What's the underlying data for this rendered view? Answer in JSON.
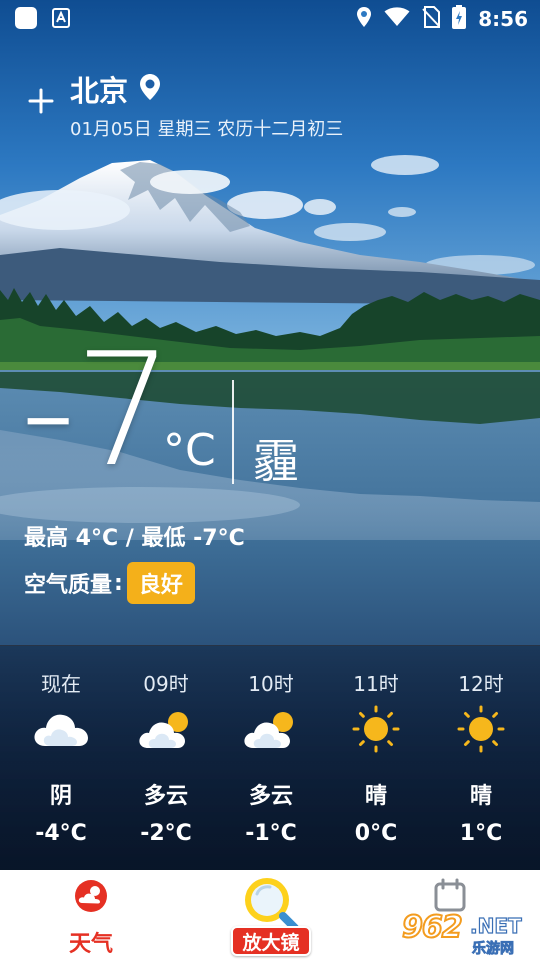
{
  "status_bar": {
    "time": "8:56",
    "icons": [
      "app-notification-icon",
      "a-badge-icon",
      "location-icon",
      "wifi-icon",
      "no-sim-icon",
      "battery-charging-icon"
    ]
  },
  "header": {
    "add_icon": "plus-icon",
    "city": "北京",
    "location_icon": "map-pin-icon",
    "date_line": "01月05日 星期三  农历十二月初三"
  },
  "current": {
    "temperature": "-7",
    "unit": "°C",
    "condition": "霾",
    "high_low": "最高 4°C / 最低 -7°C",
    "air_quality_label": "空气质量",
    "air_quality_colon": ":",
    "air_quality_value": "良好",
    "air_quality_color": "#f4b01a"
  },
  "hourly": [
    {
      "time": "现在",
      "icon": "cloudy-icon",
      "condition": "阴",
      "temp": "-4°C"
    },
    {
      "time": "09时",
      "icon": "partly-cloudy-icon",
      "condition": "多云",
      "temp": "-2°C"
    },
    {
      "time": "10时",
      "icon": "partly-cloudy-icon",
      "condition": "多云",
      "temp": "-1°C"
    },
    {
      "time": "11时",
      "icon": "sunny-icon",
      "condition": "晴",
      "temp": "0°C"
    },
    {
      "time": "12时",
      "icon": "sunny-icon",
      "condition": "晴",
      "temp": "1°C"
    }
  ],
  "bottom_nav": {
    "weather_label": "天气",
    "magnifier_label": "放大镜",
    "calendar_icon": "calendar-icon",
    "accent_color": "#e53023"
  },
  "watermark": {
    "number": "962",
    "suffix": ".NET",
    "site": "乐游网"
  }
}
